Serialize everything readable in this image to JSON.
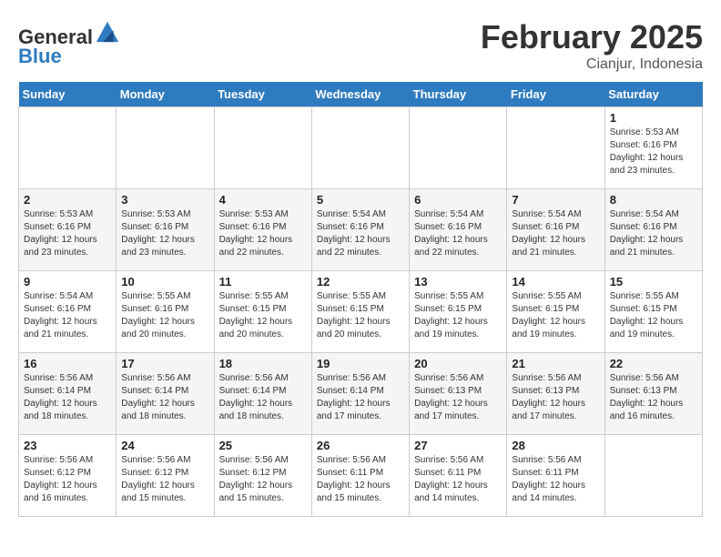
{
  "header": {
    "logo_line1": "General",
    "logo_line2": "Blue",
    "title": "February 2025",
    "subtitle": "Cianjur, Indonesia"
  },
  "days_of_week": [
    "Sunday",
    "Monday",
    "Tuesday",
    "Wednesday",
    "Thursday",
    "Friday",
    "Saturday"
  ],
  "weeks": [
    [
      {
        "day": "",
        "detail": ""
      },
      {
        "day": "",
        "detail": ""
      },
      {
        "day": "",
        "detail": ""
      },
      {
        "day": "",
        "detail": ""
      },
      {
        "day": "",
        "detail": ""
      },
      {
        "day": "",
        "detail": ""
      },
      {
        "day": "1",
        "detail": "Sunrise: 5:53 AM\nSunset: 6:16 PM\nDaylight: 12 hours\nand 23 minutes."
      }
    ],
    [
      {
        "day": "2",
        "detail": "Sunrise: 5:53 AM\nSunset: 6:16 PM\nDaylight: 12 hours\nand 23 minutes."
      },
      {
        "day": "3",
        "detail": "Sunrise: 5:53 AM\nSunset: 6:16 PM\nDaylight: 12 hours\nand 23 minutes."
      },
      {
        "day": "4",
        "detail": "Sunrise: 5:53 AM\nSunset: 6:16 PM\nDaylight: 12 hours\nand 22 minutes."
      },
      {
        "day": "5",
        "detail": "Sunrise: 5:54 AM\nSunset: 6:16 PM\nDaylight: 12 hours\nand 22 minutes."
      },
      {
        "day": "6",
        "detail": "Sunrise: 5:54 AM\nSunset: 6:16 PM\nDaylight: 12 hours\nand 22 minutes."
      },
      {
        "day": "7",
        "detail": "Sunrise: 5:54 AM\nSunset: 6:16 PM\nDaylight: 12 hours\nand 21 minutes."
      },
      {
        "day": "8",
        "detail": "Sunrise: 5:54 AM\nSunset: 6:16 PM\nDaylight: 12 hours\nand 21 minutes."
      }
    ],
    [
      {
        "day": "9",
        "detail": "Sunrise: 5:54 AM\nSunset: 6:16 PM\nDaylight: 12 hours\nand 21 minutes."
      },
      {
        "day": "10",
        "detail": "Sunrise: 5:55 AM\nSunset: 6:16 PM\nDaylight: 12 hours\nand 20 minutes."
      },
      {
        "day": "11",
        "detail": "Sunrise: 5:55 AM\nSunset: 6:15 PM\nDaylight: 12 hours\nand 20 minutes."
      },
      {
        "day": "12",
        "detail": "Sunrise: 5:55 AM\nSunset: 6:15 PM\nDaylight: 12 hours\nand 20 minutes."
      },
      {
        "day": "13",
        "detail": "Sunrise: 5:55 AM\nSunset: 6:15 PM\nDaylight: 12 hours\nand 19 minutes."
      },
      {
        "day": "14",
        "detail": "Sunrise: 5:55 AM\nSunset: 6:15 PM\nDaylight: 12 hours\nand 19 minutes."
      },
      {
        "day": "15",
        "detail": "Sunrise: 5:55 AM\nSunset: 6:15 PM\nDaylight: 12 hours\nand 19 minutes."
      }
    ],
    [
      {
        "day": "16",
        "detail": "Sunrise: 5:56 AM\nSunset: 6:14 PM\nDaylight: 12 hours\nand 18 minutes."
      },
      {
        "day": "17",
        "detail": "Sunrise: 5:56 AM\nSunset: 6:14 PM\nDaylight: 12 hours\nand 18 minutes."
      },
      {
        "day": "18",
        "detail": "Sunrise: 5:56 AM\nSunset: 6:14 PM\nDaylight: 12 hours\nand 18 minutes."
      },
      {
        "day": "19",
        "detail": "Sunrise: 5:56 AM\nSunset: 6:14 PM\nDaylight: 12 hours\nand 17 minutes."
      },
      {
        "day": "20",
        "detail": "Sunrise: 5:56 AM\nSunset: 6:13 PM\nDaylight: 12 hours\nand 17 minutes."
      },
      {
        "day": "21",
        "detail": "Sunrise: 5:56 AM\nSunset: 6:13 PM\nDaylight: 12 hours\nand 17 minutes."
      },
      {
        "day": "22",
        "detail": "Sunrise: 5:56 AM\nSunset: 6:13 PM\nDaylight: 12 hours\nand 16 minutes."
      }
    ],
    [
      {
        "day": "23",
        "detail": "Sunrise: 5:56 AM\nSunset: 6:12 PM\nDaylight: 12 hours\nand 16 minutes."
      },
      {
        "day": "24",
        "detail": "Sunrise: 5:56 AM\nSunset: 6:12 PM\nDaylight: 12 hours\nand 15 minutes."
      },
      {
        "day": "25",
        "detail": "Sunrise: 5:56 AM\nSunset: 6:12 PM\nDaylight: 12 hours\nand 15 minutes."
      },
      {
        "day": "26",
        "detail": "Sunrise: 5:56 AM\nSunset: 6:11 PM\nDaylight: 12 hours\nand 15 minutes."
      },
      {
        "day": "27",
        "detail": "Sunrise: 5:56 AM\nSunset: 6:11 PM\nDaylight: 12 hours\nand 14 minutes."
      },
      {
        "day": "28",
        "detail": "Sunrise: 5:56 AM\nSunset: 6:11 PM\nDaylight: 12 hours\nand 14 minutes."
      },
      {
        "day": "",
        "detail": ""
      }
    ]
  ]
}
